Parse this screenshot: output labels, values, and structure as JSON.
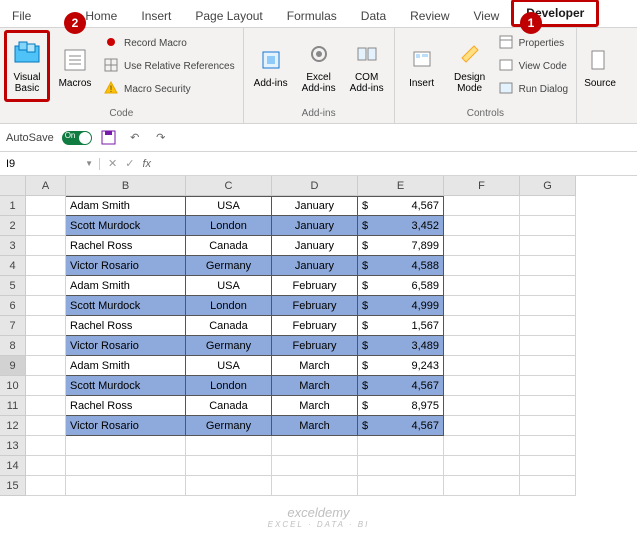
{
  "tabs": [
    "File",
    "Home",
    "Insert",
    "Page Layout",
    "Formulas",
    "Data",
    "Review",
    "View",
    "Developer"
  ],
  "callouts": {
    "one": "1",
    "two": "2"
  },
  "ribbon": {
    "code": {
      "visual_basic": "Visual Basic",
      "macros": "Macros",
      "record_macro": "Record Macro",
      "use_relative": "Use Relative References",
      "macro_security": "Macro Security",
      "label": "Code"
    },
    "addins": {
      "addins": "Add-ins",
      "excel_addins": "Excel Add-ins",
      "com_addins": "COM Add-ins",
      "label": "Add-ins"
    },
    "controls": {
      "insert": "Insert",
      "design_mode": "Design Mode",
      "properties": "Properties",
      "view_code": "View Code",
      "run_dialog": "Run Dialog",
      "label": "Controls"
    },
    "xml": {
      "source": "Source"
    }
  },
  "autosave": {
    "label": "AutoSave",
    "state": "On"
  },
  "namebox": "I9",
  "fx": "fx",
  "columns": [
    "A",
    "B",
    "C",
    "D",
    "E",
    "F",
    "G"
  ],
  "rows": [
    {
      "n": 1,
      "name": "Adam Smith",
      "loc": "USA",
      "month": "January",
      "amt": "4,567",
      "shade": false
    },
    {
      "n": 2,
      "name": "Scott Murdock",
      "loc": "London",
      "month": "January",
      "amt": "3,452",
      "shade": true
    },
    {
      "n": 3,
      "name": "Rachel Ross",
      "loc": "Canada",
      "month": "January",
      "amt": "7,899",
      "shade": false
    },
    {
      "n": 4,
      "name": "Victor Rosario",
      "loc": "Germany",
      "month": "January",
      "amt": "4,588",
      "shade": true
    },
    {
      "n": 5,
      "name": "Adam Smith",
      "loc": "USA",
      "month": "February",
      "amt": "6,589",
      "shade": false
    },
    {
      "n": 6,
      "name": "Scott Murdock",
      "loc": "London",
      "month": "February",
      "amt": "4,999",
      "shade": true
    },
    {
      "n": 7,
      "name": "Rachel Ross",
      "loc": "Canada",
      "month": "February",
      "amt": "1,567",
      "shade": false
    },
    {
      "n": 8,
      "name": "Victor Rosario",
      "loc": "Germany",
      "month": "February",
      "amt": "3,489",
      "shade": true
    },
    {
      "n": 9,
      "name": "Adam Smith",
      "loc": "USA",
      "month": "March",
      "amt": "9,243",
      "shade": false
    },
    {
      "n": 10,
      "name": "Scott Murdock",
      "loc": "London",
      "month": "March",
      "amt": "4,567",
      "shade": true
    },
    {
      "n": 11,
      "name": "Rachel Ross",
      "loc": "Canada",
      "month": "March",
      "amt": "8,975",
      "shade": false
    },
    {
      "n": 12,
      "name": "Victor Rosario",
      "loc": "Germany",
      "month": "March",
      "amt": "4,567",
      "shade": true
    }
  ],
  "empty_rows": [
    13,
    14,
    15
  ],
  "currency": "$",
  "watermark": {
    "main": "exceldemy",
    "sub": "EXCEL · DATA · BI"
  }
}
